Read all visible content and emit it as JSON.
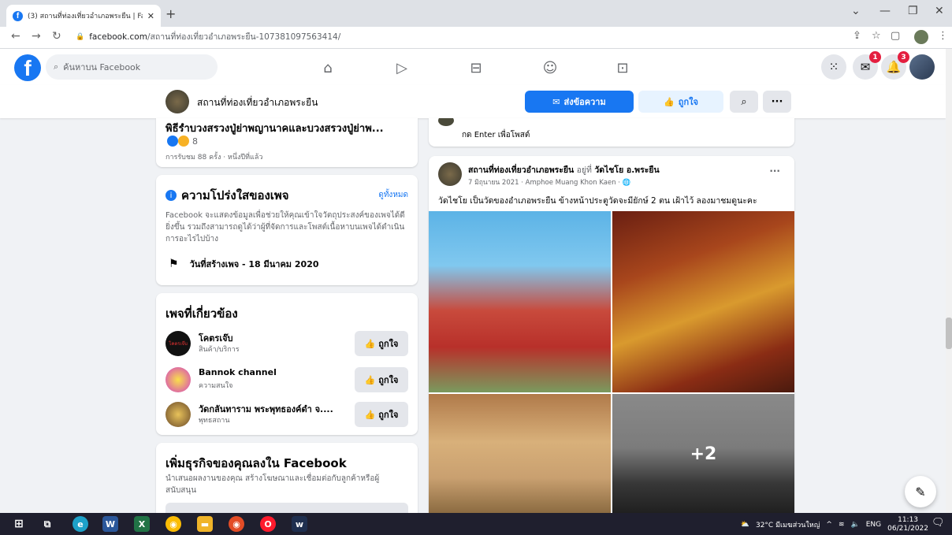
{
  "browser": {
    "tab_title": "(3) สถานที่ท่องเที่ยวอำเภอพระยืน | Fa",
    "tab_close": "✕",
    "new_tab": "+",
    "url_domain": "facebook.com",
    "url_path": "/สถานที่ท่องเที่ยวอำเภอพระยืน-107381097563414/"
  },
  "fb_header": {
    "logo": "f",
    "search_placeholder": "ค้นหาบน Facebook",
    "messenger_badge": "1",
    "notifications_badge": "3"
  },
  "page_header": {
    "page_name": "สถานที่ท่องเที่ยวอำเภอพระยืน",
    "message_label": "ส่งข้อความ",
    "like_label": "ถูกใจ",
    "more_label": "···"
  },
  "left": {
    "top_post": {
      "title": "พิธีรำบวงสรวงปู่ย่าพญานาคและบวงสรวงปู่ย่าพ...",
      "reaction_count": "8",
      "views": "การรับชม 88 ครั้ง · หนึ่งปีที่แล้ว"
    },
    "transparency": {
      "title": "ความโปร่งใสของเพจ",
      "see_all": "ดูทั้งหมด",
      "body": "Facebook จะแสดงข้อมูลเพื่อช่วยให้คุณเข้าใจวัตถุประสงค์ของเพจได้ดียิ่งขึ้น รวมถึงสามารถดูได้ว่าผู้ที่จัดการและโพสต์เนื้อหาบนเพจได้ดำเนินการอะไรไปบ้าง",
      "created": "วันที่สร้างเพจ - 18 มีนาคม 2020"
    },
    "related": {
      "title": "เพจที่เกี่ยวข้อง",
      "like_label": "ถูกใจ",
      "items": [
        {
          "name": "โคตรเจ๊บ",
          "category": "สินค้า/บริการ",
          "avatar_text": "โคตรเจ๊บ"
        },
        {
          "name": "Bannok channel",
          "category": "ความสนใจ",
          "avatar_text": ""
        },
        {
          "name": "วัดกลันทาราม พระพุทธองค์ดำ จ....",
          "category": "พุทธสถาน",
          "avatar_text": ""
        }
      ]
    },
    "business": {
      "title": "เพิ่มธุรกิจของคุณลงใน Facebook",
      "body": "นำเสนอผลงานของคุณ สร้างโฆษณาและเชื่อมต่อกับลูกค้าหรือผู้สนับสนุน"
    }
  },
  "right": {
    "comment_hint": "กด Enter เพื่อโพสต์",
    "post": {
      "author": "สถานที่ท่องเที่ยวอำเภอพระยืน",
      "at_word": "อยู่ที่",
      "place": "วัดไชโย อ.พระยืน",
      "meta": "7 มิถุนายน 2021 · Amphoe Muang Khon Kaen · ",
      "text": "วัดไชโย เป็นวัดของอำเภอพระยืน ข้างหน้าประตูวัดจะมียักษ์ 2 ตน เฝ้าไว้ ลองมาชมดูนะคะ",
      "more_photos": "+2",
      "menu": "···"
    }
  },
  "taskbar": {
    "weather": "32°C มีเมฆส่วนใหญ่",
    "lang": "ENG",
    "time": "11:13",
    "date": "06/21/2022"
  },
  "colors": {
    "brand": "#1877f2",
    "badge": "#e41e3f"
  }
}
